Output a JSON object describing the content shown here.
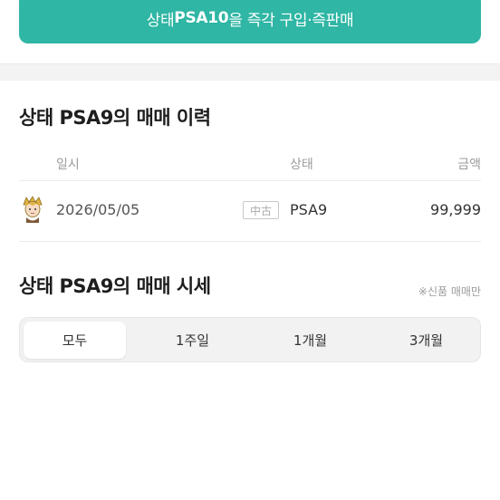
{
  "buy_button": {
    "prefix": "상태 ",
    "grade": "PSA10",
    "suffix": "을 즉각 구입·즉판매"
  },
  "trade_history": {
    "title": "상태 PSA9의 매매 이력",
    "columns": {
      "date": "일시",
      "condition": "상태",
      "price": "금액"
    },
    "rows": [
      {
        "date": "2026/05/05",
        "badge": "中古",
        "condition": "PSA9",
        "price": "99,999",
        "avatar_icon": "user-avatar-icon"
      }
    ]
  },
  "market_price": {
    "title": "상태 PSA9의 매매 시세",
    "note": "※신품 매매만",
    "tabs": [
      {
        "label": "모두",
        "active": true
      },
      {
        "label": "1주일",
        "active": false
      },
      {
        "label": "1개월",
        "active": false
      },
      {
        "label": "3개월",
        "active": false
      }
    ]
  },
  "colors": {
    "accent": "#2fb6a4"
  }
}
